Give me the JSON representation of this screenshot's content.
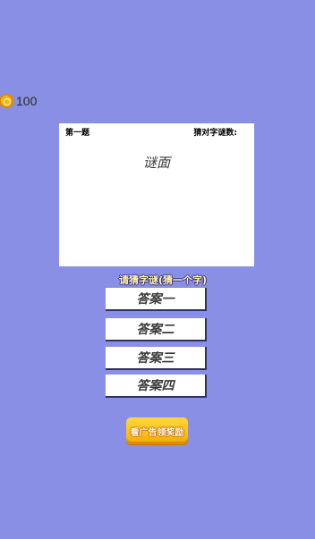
{
  "coins": {
    "icon": "coin-icon",
    "count": "100"
  },
  "riddle": {
    "question_number": "第一题",
    "solved_label": "猜对字谜数:",
    "text": "谜面"
  },
  "prompt": "请猜字谜(猜一个字)",
  "answers": [
    {
      "label": "答案一"
    },
    {
      "label": "答案二"
    },
    {
      "label": "答案三"
    },
    {
      "label": "答案四"
    }
  ],
  "reward_button": {
    "label": "看广告领奖励"
  },
  "colors": {
    "background": "#8a8fe6",
    "reward_button": "#ffc21a",
    "prompt_text": "#fff5a8"
  }
}
